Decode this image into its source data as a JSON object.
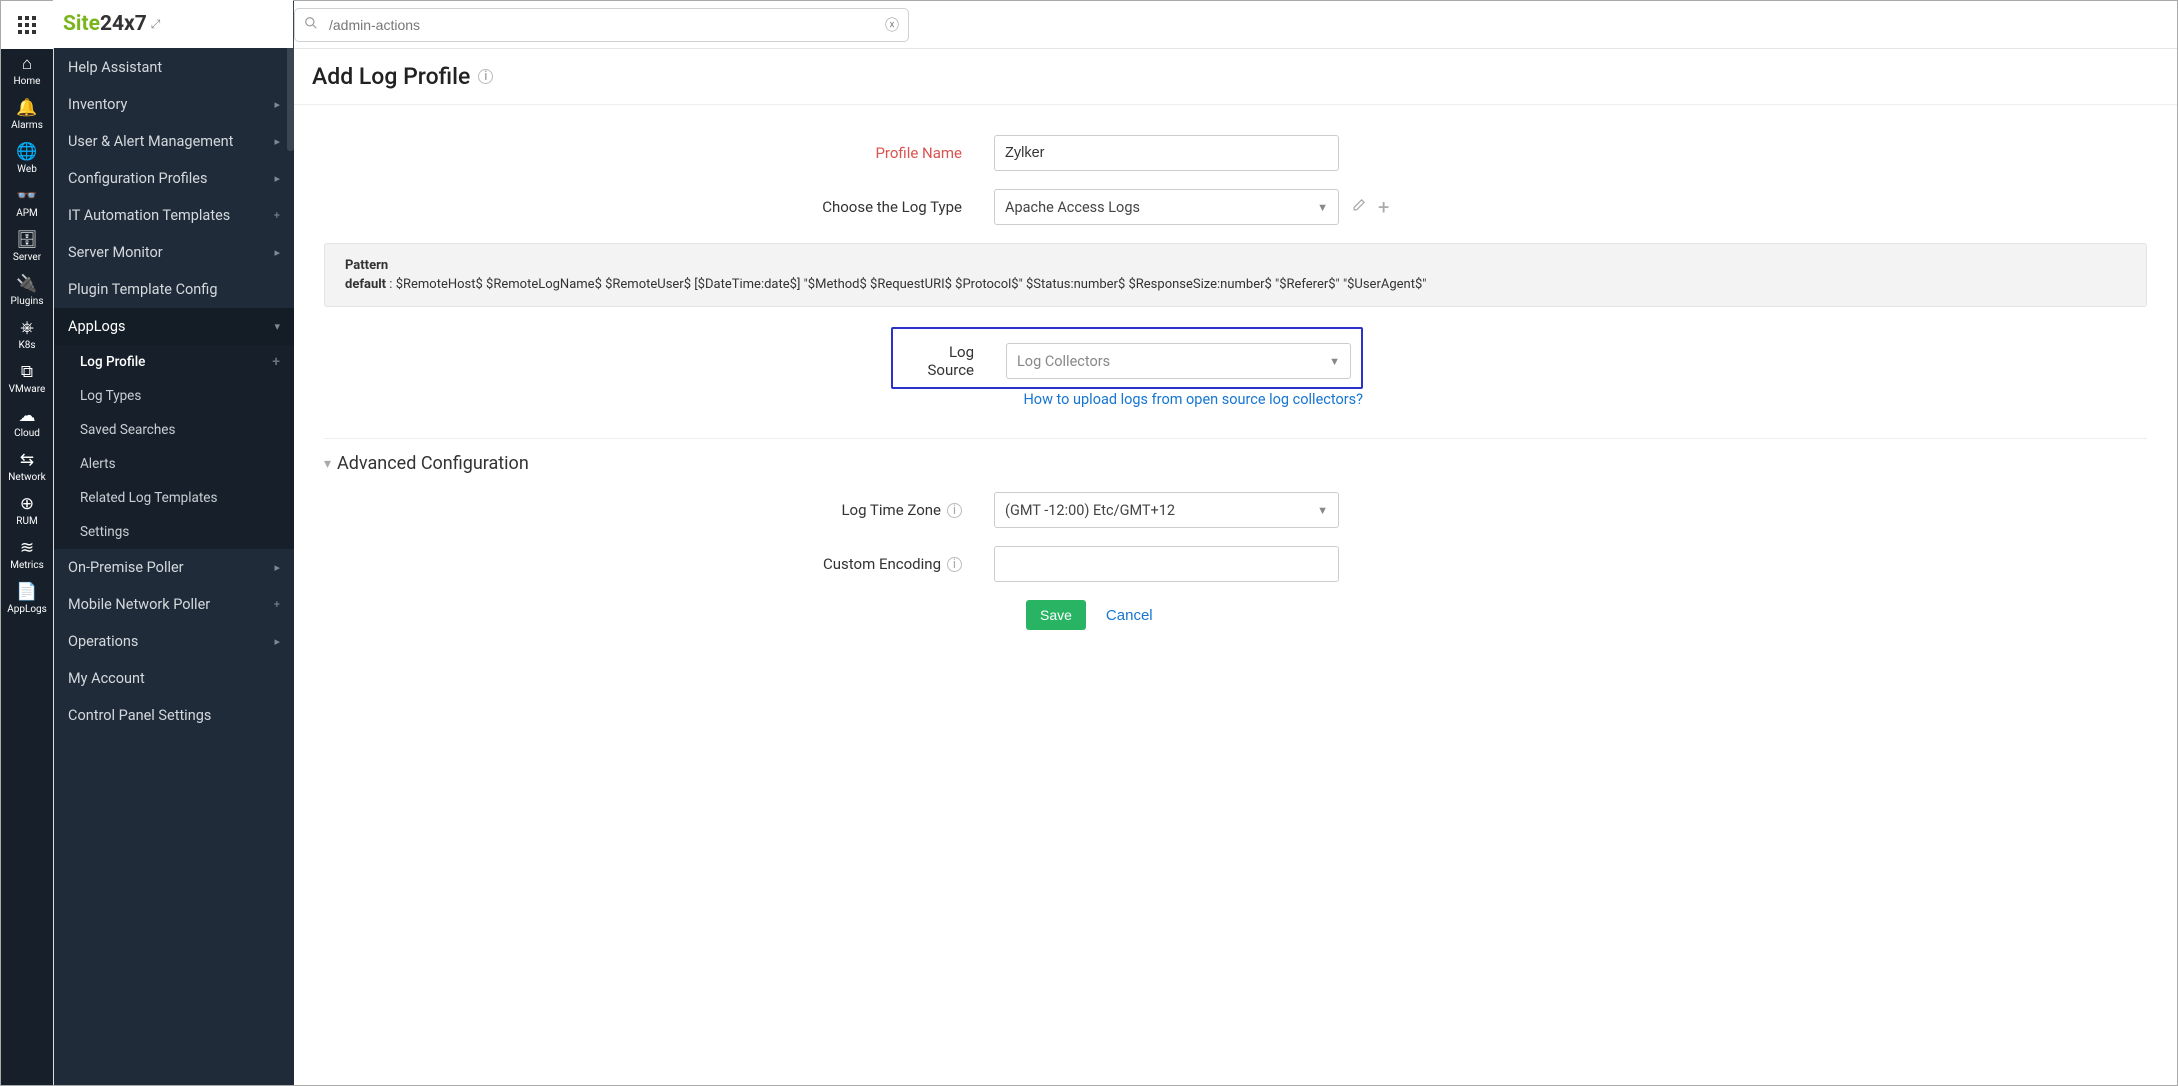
{
  "brand": {
    "site": "Site",
    "two47": "24x7"
  },
  "search": {
    "value": "/admin-actions"
  },
  "rail": [
    {
      "icon": "⌂",
      "label": "Home"
    },
    {
      "icon": "🔔",
      "label": "Alarms"
    },
    {
      "icon": "🌐",
      "label": "Web"
    },
    {
      "icon": "👓",
      "label": "APM"
    },
    {
      "icon": "🗄",
      "label": "Server"
    },
    {
      "icon": "🔌",
      "label": "Plugins"
    },
    {
      "icon": "⎈",
      "label": "K8s"
    },
    {
      "icon": "⧉",
      "label": "VMware"
    },
    {
      "icon": "☁",
      "label": "Cloud"
    },
    {
      "icon": "⇆",
      "label": "Network"
    },
    {
      "icon": "⊕",
      "label": "RUM"
    },
    {
      "icon": "≋",
      "label": "Metrics"
    },
    {
      "icon": "📄",
      "label": "AppLogs"
    }
  ],
  "sidebar": {
    "items": [
      {
        "label": "Help Assistant",
        "caret": ""
      },
      {
        "label": "Inventory",
        "caret": "▸"
      },
      {
        "label": "User & Alert Management",
        "caret": "▸"
      },
      {
        "label": "Configuration Profiles",
        "caret": "▸"
      },
      {
        "label": "IT Automation Templates",
        "caret": "+"
      },
      {
        "label": "Server Monitor",
        "caret": "▸"
      },
      {
        "label": "Plugin Template Config",
        "caret": ""
      },
      {
        "label": "AppLogs",
        "caret": "▾"
      },
      {
        "label": "On-Premise Poller",
        "caret": "▸"
      },
      {
        "label": "Mobile Network Poller",
        "caret": "+"
      },
      {
        "label": "Operations",
        "caret": "▸"
      },
      {
        "label": "My Account",
        "caret": ""
      },
      {
        "label": "Control Panel Settings",
        "caret": ""
      }
    ],
    "subitems": [
      {
        "label": "Log Profile",
        "active": true,
        "plus": "+"
      },
      {
        "label": "Log Types"
      },
      {
        "label": "Saved Searches"
      },
      {
        "label": "Alerts"
      },
      {
        "label": "Related Log Templates"
      },
      {
        "label": "Settings"
      }
    ]
  },
  "page": {
    "title": "Add Log Profile"
  },
  "form": {
    "profile_name_label": "Profile Name",
    "profile_name_value": "Zylker",
    "log_type_label": "Choose the Log Type",
    "log_type_value": "Apache Access Logs",
    "pattern_title": "Pattern",
    "pattern_prefix": "default",
    "pattern_text": "$RemoteHost$ $RemoteLogName$ $RemoteUser$ [$DateTime:date$] \"$Method$ $RequestURI$ $Protocol$\" $Status:number$ $ResponseSize:number$ \"$Referer$\" \"$UserAgent$\"",
    "log_source_label": "Log Source",
    "log_source_value": "Log Collectors",
    "help_link": "How to upload logs from open source log collectors?",
    "advanced_title": "Advanced Configuration",
    "timezone_label": "Log Time Zone",
    "timezone_value": "(GMT -12:00) Etc/GMT+12",
    "encoding_label": "Custom Encoding",
    "encoding_value": "",
    "save": "Save",
    "cancel": "Cancel"
  }
}
